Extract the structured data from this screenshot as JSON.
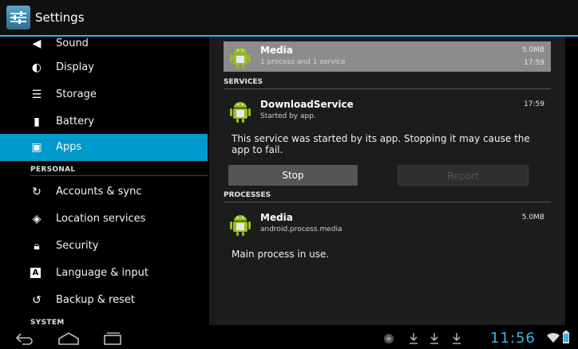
{
  "actionbar": {
    "title": "Settings"
  },
  "nav": {
    "items": [
      {
        "label": "Sound",
        "icon": "speaker-icon"
      },
      {
        "label": "Display",
        "icon": "brightness-icon"
      },
      {
        "label": "Storage",
        "icon": "storage-icon"
      },
      {
        "label": "Battery",
        "icon": "battery-icon"
      },
      {
        "label": "Apps",
        "icon": "apps-icon",
        "selected": true
      },
      {
        "label": "Accounts & sync",
        "icon": "sync-icon"
      },
      {
        "label": "Location services",
        "icon": "location-icon"
      },
      {
        "label": "Security",
        "icon": "lock-icon"
      },
      {
        "label": "Language & input",
        "icon": "keyboard-icon"
      },
      {
        "label": "Backup & reset",
        "icon": "backup-icon"
      }
    ],
    "headers": {
      "personal": "PERSONAL",
      "system": "SYSTEM"
    }
  },
  "detail": {
    "app": {
      "name": "Media",
      "summary": "1 process and 1 service",
      "size": "5.0MB",
      "time": "17:59"
    },
    "services_header": "SERVICES",
    "service": {
      "name": "DownloadService",
      "status": "Started by app.",
      "time": "17:59"
    },
    "service_desc": "This service was started by its app. Stopping it may cause the app to fail.",
    "stop_label": "Stop",
    "report_label": "Report",
    "processes_header": "PROCESSES",
    "process": {
      "name": "Media",
      "package": "android.process.media",
      "size": "5.0MB"
    },
    "process_desc": "Main process in use."
  },
  "statusbar": {
    "time": "11:56"
  },
  "colors": {
    "accent": "#33b5e5",
    "selected": "#0099cc",
    "pane_bg": "#1c1c1c",
    "highlight_row": "#8c8c8c"
  }
}
